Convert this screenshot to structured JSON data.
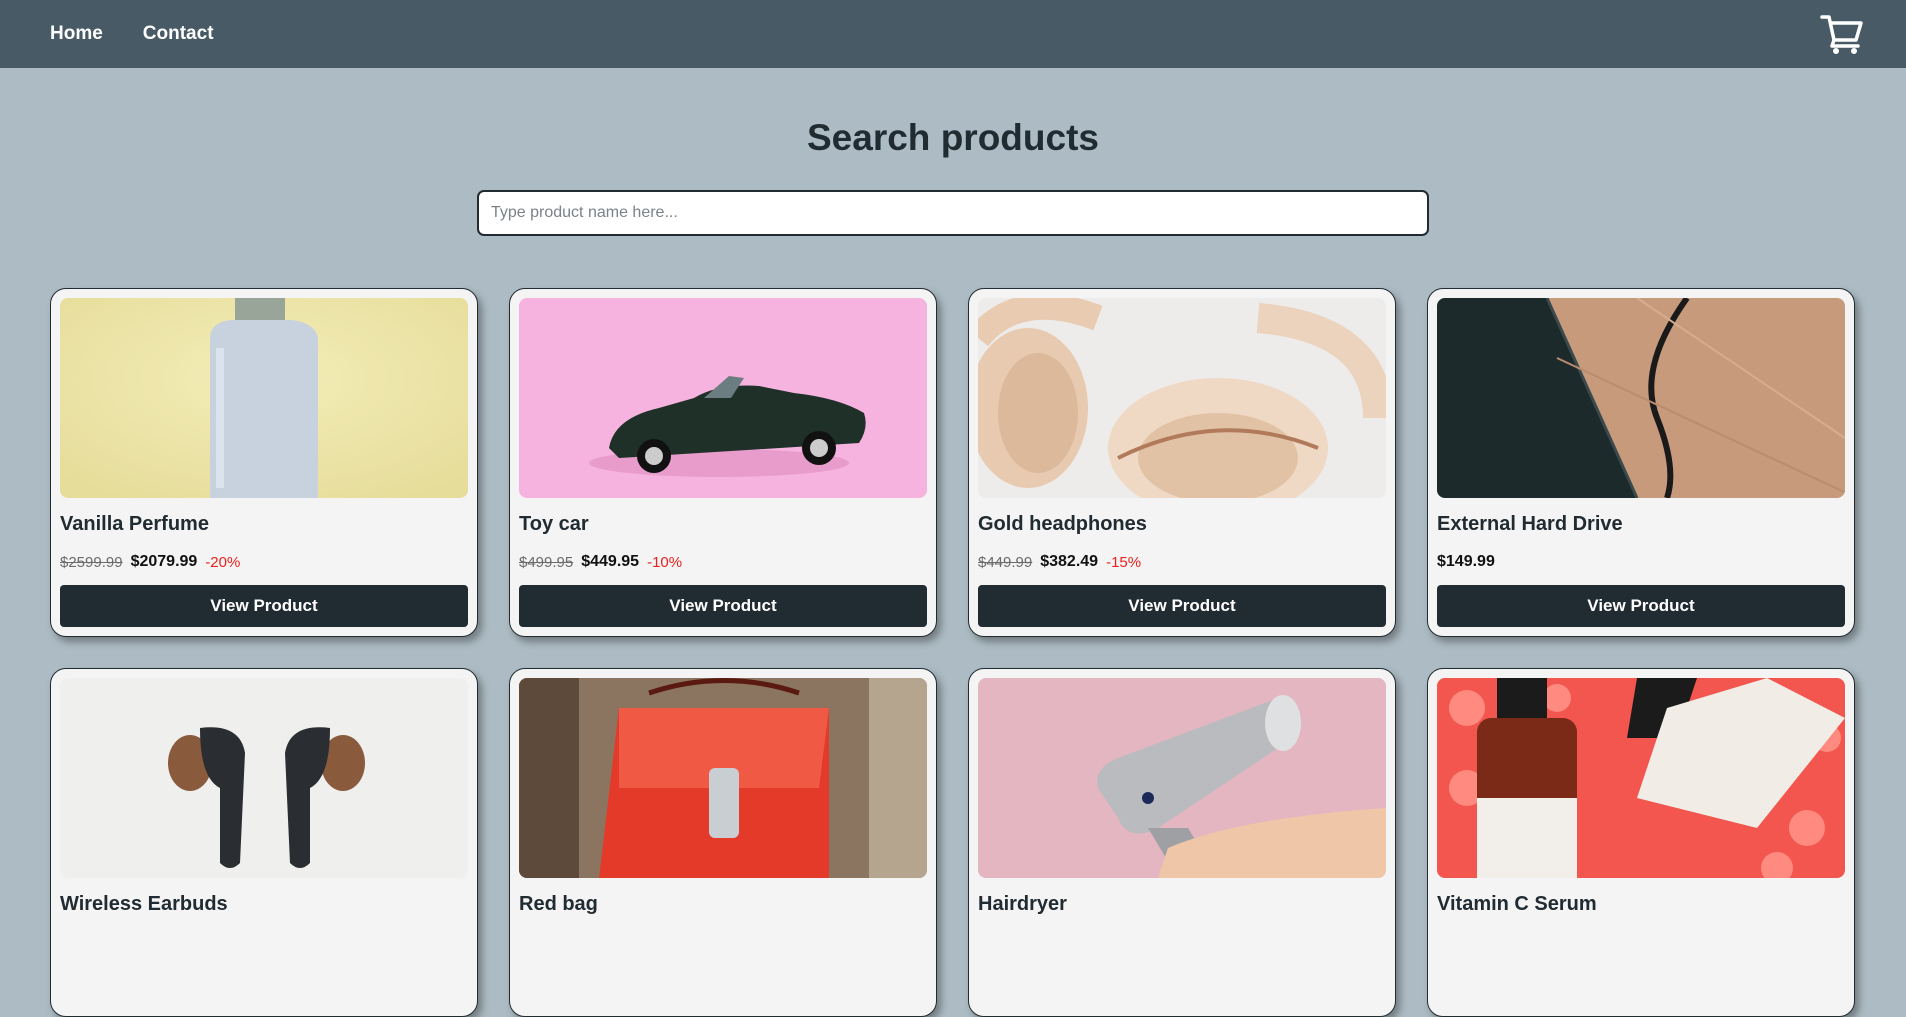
{
  "nav": {
    "home": "Home",
    "contact": "Contact",
    "cart_icon": "shopping-cart-icon"
  },
  "heading": "Search products",
  "search": {
    "placeholder": "Type product name here...",
    "value": ""
  },
  "colors": {
    "navbar": "#475a66",
    "background": "#adbcc4",
    "button": "#212b32",
    "discount": "#e8221e"
  },
  "products": [
    {
      "name": "Vanilla Perfume",
      "old_price": "$2599.99",
      "price": "$2079.99",
      "discount": "-20%",
      "button": "View Product",
      "image": "perfume-bottle-image"
    },
    {
      "name": "Toy car",
      "old_price": "$499.95",
      "price": "$449.95",
      "discount": "-10%",
      "button": "View Product",
      "image": "toy-car-image"
    },
    {
      "name": "Gold headphones",
      "old_price": "$449.99",
      "price": "$382.49",
      "discount": "-15%",
      "button": "View Product",
      "image": "headphones-image"
    },
    {
      "name": "External Hard Drive",
      "old_price": "",
      "price": "$149.99",
      "discount": "",
      "button": "View Product",
      "image": "hard-drive-image"
    },
    {
      "name": "Wireless Earbuds",
      "image": "earbuds-image"
    },
    {
      "name": "Red bag",
      "image": "red-bag-image"
    },
    {
      "name": "Hairdryer",
      "image": "hairdryer-image"
    },
    {
      "name": "Vitamin C Serum",
      "image": "serum-bottles-image"
    }
  ]
}
